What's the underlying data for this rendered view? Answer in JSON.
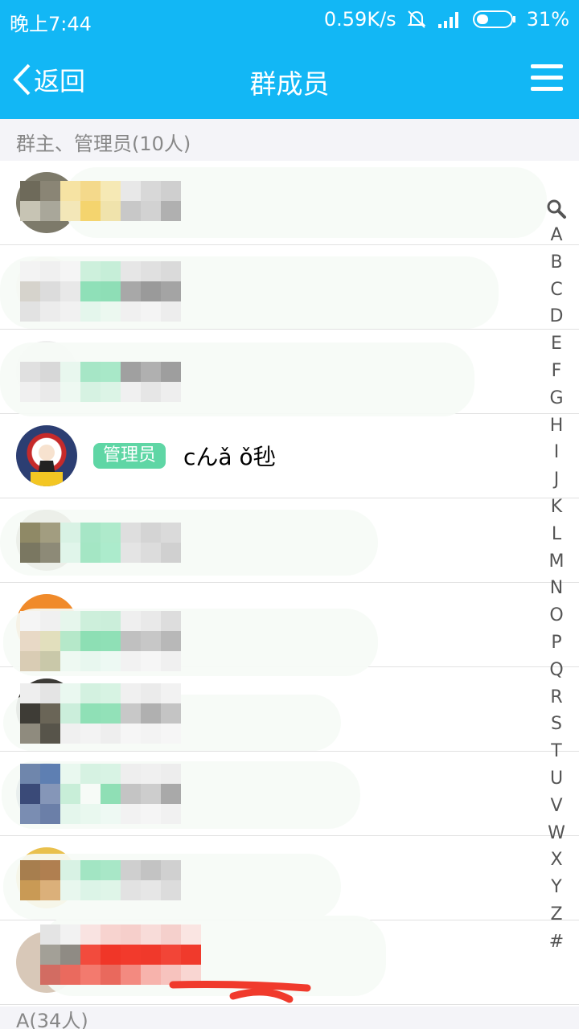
{
  "status_bar": {
    "time": "晚上7:44",
    "network_speed": "0.59K/s",
    "battery": "31%"
  },
  "nav": {
    "back_label": "返回",
    "title": "群成员"
  },
  "sections": {
    "admins_header": "群主、管理员(10人)",
    "a_header": "A(34人)"
  },
  "members": [
    {
      "badge": "",
      "name": ""
    },
    {
      "badge": "",
      "name": ""
    },
    {
      "badge": "",
      "name": ""
    },
    {
      "badge": "管理员",
      "name": "cんǎ ǒ毜"
    },
    {
      "badge": "",
      "name": ""
    },
    {
      "badge": "",
      "name": ""
    },
    {
      "badge": "",
      "name": ""
    },
    {
      "badge": "",
      "name": ""
    },
    {
      "badge": "",
      "name": ""
    },
    {
      "badge": "",
      "name": ""
    }
  ],
  "alphabet_index": [
    "A",
    "B",
    "C",
    "D",
    "E",
    "F",
    "G",
    "H",
    "I",
    "J",
    "K",
    "L",
    "M",
    "N",
    "O",
    "P",
    "Q",
    "R",
    "S",
    "T",
    "U",
    "V",
    "W",
    "X",
    "Y",
    "Z",
    "#"
  ],
  "colors": {
    "header_blue": "#12b7f5",
    "admin_badge": "#5fd6a5"
  }
}
